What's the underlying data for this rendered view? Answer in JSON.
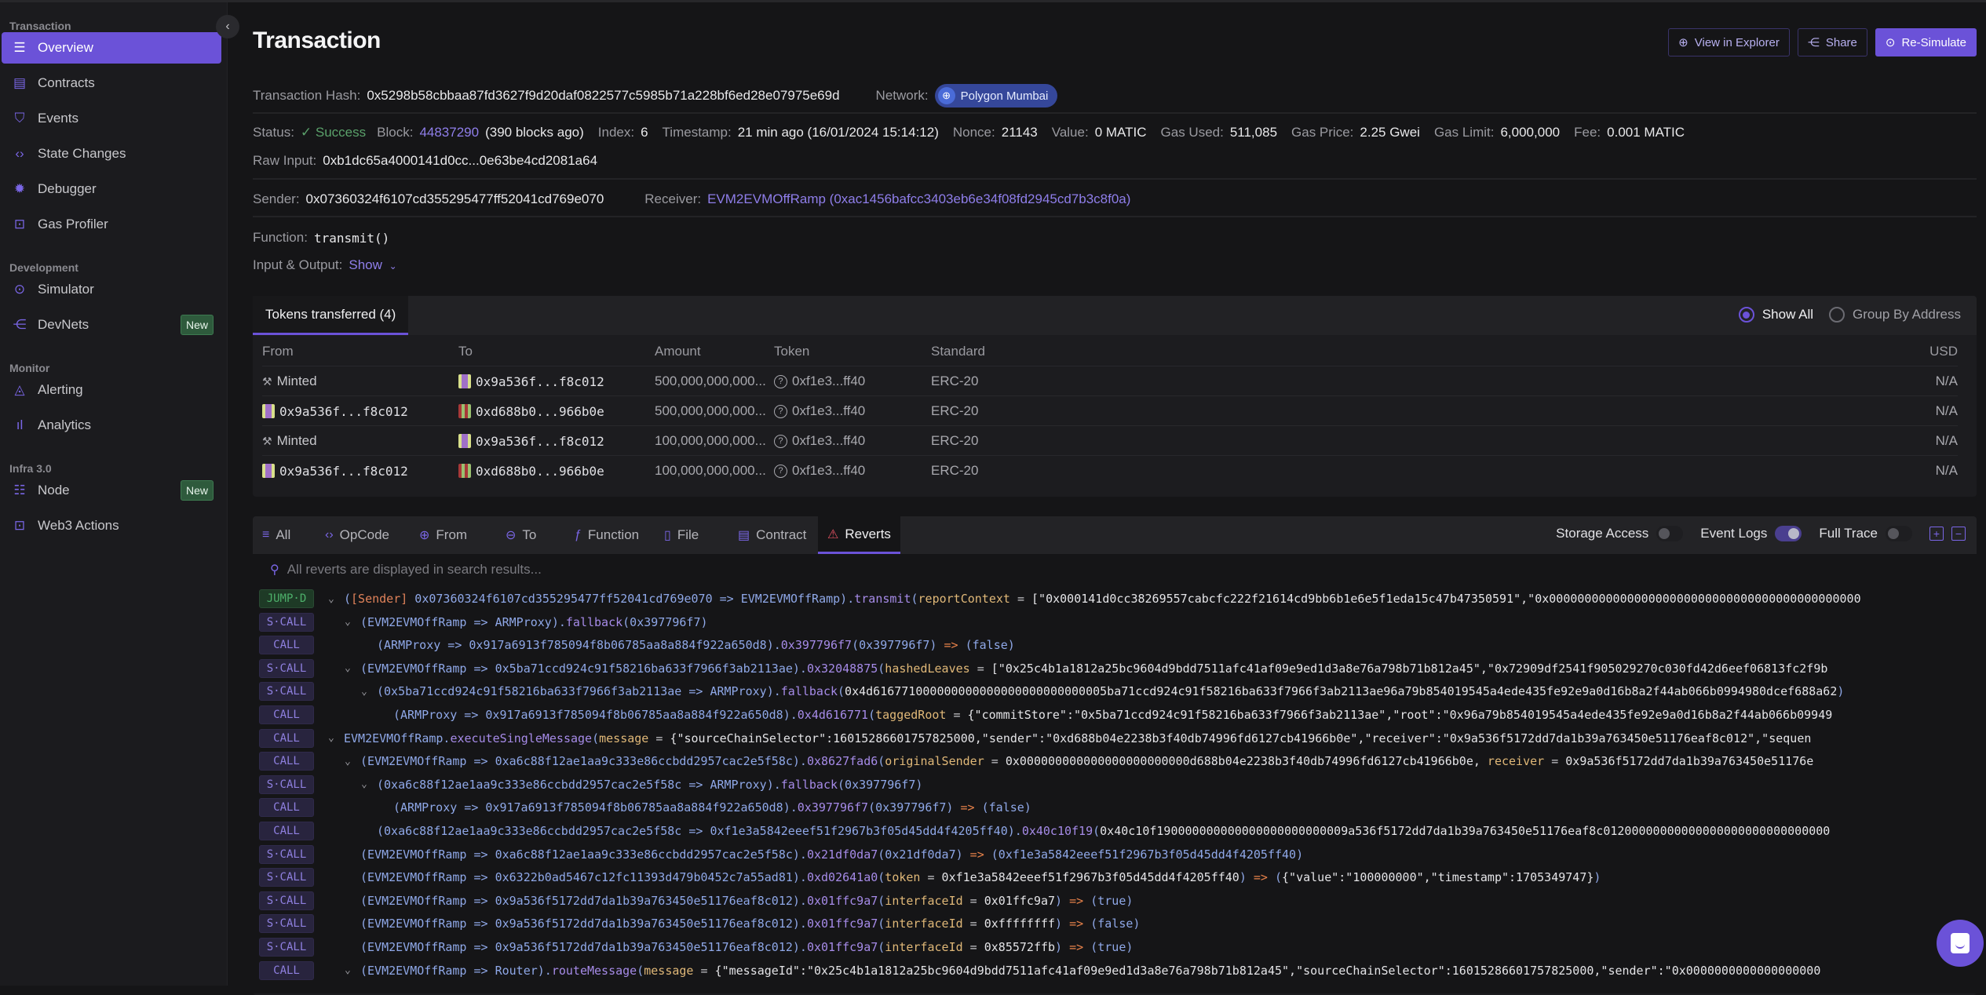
{
  "sidebar": {
    "sections": [
      {
        "title": "Transaction",
        "items": [
          {
            "label": "Overview",
            "icon": "list-icon",
            "active": true
          },
          {
            "label": "Contracts",
            "icon": "document-icon"
          },
          {
            "label": "Events",
            "icon": "bookmark-icon"
          },
          {
            "label": "State Changes",
            "icon": "code-icon"
          },
          {
            "label": "Debugger",
            "icon": "bug-icon"
          },
          {
            "label": "Gas Profiler",
            "icon": "chip-icon"
          }
        ]
      },
      {
        "title": "Development",
        "items": [
          {
            "label": "Simulator",
            "icon": "play-circle-icon"
          },
          {
            "label": "DevNets",
            "icon": "share-nodes-icon",
            "badge": "New"
          }
        ]
      },
      {
        "title": "Monitor",
        "items": [
          {
            "label": "Alerting",
            "icon": "bell-icon"
          },
          {
            "label": "Analytics",
            "icon": "bar-chart-icon"
          }
        ]
      },
      {
        "title": "Infra 3.0",
        "items": [
          {
            "label": "Node",
            "icon": "server-icon",
            "badge": "New"
          },
          {
            "label": "Web3 Actions",
            "icon": "chip-icon"
          }
        ]
      }
    ]
  },
  "header": {
    "title": "Transaction",
    "buttons": {
      "explorer": "View in Explorer",
      "share": "Share",
      "resimulate": "Re-Simulate"
    }
  },
  "tx": {
    "hash_label": "Transaction Hash:",
    "hash": "0x5298b58cbbaa87fd3627f9d20daf0822577c5985b71a228bf6ed28e07975e69d",
    "network_label": "Network:",
    "network": "Polygon Mumbai",
    "status_label": "Status:",
    "status": "✓ Success",
    "block_label": "Block:",
    "block": "44837290",
    "block_ago": "(390 blocks ago)",
    "index_label": "Index:",
    "index": "6",
    "timestamp_label": "Timestamp:",
    "timestamp": "21 min ago (16/01/2024 15:14:12)",
    "nonce_label": "Nonce:",
    "nonce": "21143",
    "value_label": "Value:",
    "value": "0 MATIC",
    "gas_used_label": "Gas Used:",
    "gas_used": "511,085",
    "gas_price_label": "Gas Price:",
    "gas_price": "2.25 Gwei",
    "gas_limit_label": "Gas Limit:",
    "gas_limit": "6,000,000",
    "fee_label": "Fee:",
    "fee": "0.001 MATIC",
    "raw_input_label": "Raw Input:",
    "raw_input": "0xb1dc65a4000141d0cc...0e63be4cd2081a64",
    "sender_label": "Sender:",
    "sender": "0x07360324f6107cd355295477ff52041cd769e070",
    "receiver_label": "Receiver:",
    "receiver": "EVM2EVMOffRamp (0xac1456bafcc3403eb6e34f08fd2945cd7b3c8f0a)",
    "function_label": "Function:",
    "function": "transmit()",
    "io_label": "Input & Output:",
    "io_toggle": "Show"
  },
  "tokens": {
    "tab": "Tokens transferred (4)",
    "radio_show_all": "Show All",
    "radio_group": "Group By Address",
    "columns": [
      "From",
      "To",
      "Amount",
      "Token",
      "Standard",
      "USD"
    ],
    "rows": [
      {
        "from": "Minted",
        "from_type": "minted",
        "to": "0x9a536f...f8c012",
        "to_blockie": "a",
        "amount": "500,000,000,000...",
        "token": "0xf1e3...ff40",
        "standard": "ERC-20",
        "usd": "N/A"
      },
      {
        "from": "0x9a536f...f8c012",
        "from_type": "a",
        "to": "0xd688b0...966b0e",
        "to_blockie": "b",
        "amount": "500,000,000,000...",
        "token": "0xf1e3...ff40",
        "standard": "ERC-20",
        "usd": "N/A"
      },
      {
        "from": "Minted",
        "from_type": "minted",
        "to": "0x9a536f...f8c012",
        "to_blockie": "a",
        "amount": "100,000,000,000...",
        "token": "0xf1e3...ff40",
        "standard": "ERC-20",
        "usd": "N/A"
      },
      {
        "from": "0x9a536f...f8c012",
        "from_type": "a",
        "to": "0xd688b0...966b0e",
        "to_blockie": "b",
        "amount": "100,000,000,000...",
        "token": "0xf1e3...ff40",
        "standard": "ERC-20",
        "usd": "N/A"
      }
    ]
  },
  "trace": {
    "tabs": [
      {
        "label": "All",
        "icon": "≡"
      },
      {
        "label": "OpCode",
        "icon": "‹›"
      },
      {
        "label": "From",
        "icon": "⊕"
      },
      {
        "label": "To",
        "icon": "⊖"
      },
      {
        "label": "Function",
        "icon": "ƒ"
      },
      {
        "label": "File",
        "icon": "▯"
      },
      {
        "label": "Contract",
        "icon": "▤"
      },
      {
        "label": "Reverts",
        "icon": "⚠",
        "active": true
      }
    ],
    "toggles": {
      "storage": "Storage Access",
      "events": "Event Logs",
      "full": "Full Trace"
    },
    "toggle_state": {
      "storage": false,
      "events": true,
      "full": false
    },
    "search_placeholder": "All reverts are displayed in search results...",
    "lines": [
      {
        "op": "JUMP·D",
        "depth": 0,
        "chev": true,
        "parts": [
          [
            "p",
            "("
          ],
          [
            "snd",
            "[Sender]"
          ],
          [
            "p",
            " 0x07360324f6107cd355295477ff52041cd769e070 => EVM2EVMOffRamp)."
          ],
          [
            "fn",
            "transmit"
          ],
          [
            "p",
            "("
          ],
          [
            "pm",
            "reportContext"
          ],
          [
            "w",
            " = "
          ],
          [
            "s",
            "[\"0x000141d0cc38269557cabcfc222f21614cd9bb6b1e6e5f1eda15c47b47350591\",\"0x00000000000000000000000000000000000000000000"
          ]
        ]
      },
      {
        "op": "S·CALL",
        "depth": 1,
        "chev": true,
        "parts": [
          [
            "p",
            "(EVM2EVMOffRamp => ARMProxy)."
          ],
          [
            "fn",
            "fallback"
          ],
          [
            "p",
            "(0x397796f7)"
          ]
        ]
      },
      {
        "op": "CALL",
        "depth": 2,
        "chev": false,
        "parts": [
          [
            "p",
            "(ARMProxy => 0x917a6913f785094f8b06785aa8a884f922a650d8)."
          ],
          [
            "fn",
            "0x397796f7"
          ],
          [
            "p",
            "(0x397796f7)"
          ],
          [
            "ar",
            " => "
          ],
          [
            "p",
            "(false)"
          ]
        ]
      },
      {
        "op": "S·CALL",
        "depth": 1,
        "chev": true,
        "parts": [
          [
            "p",
            "(EVM2EVMOffRamp => 0x5ba71ccd924c91f58216ba633f7966f3ab2113ae)."
          ],
          [
            "fn",
            "0x32048875"
          ],
          [
            "p",
            "("
          ],
          [
            "pm",
            "hashedLeaves"
          ],
          [
            "w",
            " = "
          ],
          [
            "s",
            "[\"0x25c4b1a1812a25bc9604d9bdd7511afc41af09e9ed1d3a8e76a798b71b812a45\",\"0x72909df2541f905029270c030fd42d6eef06813fc2f9b"
          ]
        ]
      },
      {
        "op": "S·CALL",
        "depth": 2,
        "chev": true,
        "parts": [
          [
            "p",
            "(0x5ba71ccd924c91f58216ba633f7966f3ab2113ae => ARMProxy)."
          ],
          [
            "fn",
            "fallback"
          ],
          [
            "p",
            "("
          ],
          [
            "s",
            "0x4d616771000000000000000000000000005ba71ccd924c91f58216ba633f7966f3ab2113ae96a79b854019545a4ede435fe92e9a0d16b8a2f44ab066b0994980dcef688a62"
          ],
          [
            "p",
            ")"
          ]
        ]
      },
      {
        "op": "CALL",
        "depth": 3,
        "chev": false,
        "parts": [
          [
            "p",
            "(ARMProxy => 0x917a6913f785094f8b06785aa8a884f922a650d8)."
          ],
          [
            "fn",
            "0x4d616771"
          ],
          [
            "p",
            "("
          ],
          [
            "pm",
            "taggedRoot"
          ],
          [
            "w",
            " = "
          ],
          [
            "s",
            "{\"commitStore\":\"0x5ba71ccd924c91f58216ba633f7966f3ab2113ae\",\"root\":\"0x96a79b854019545a4ede435fe92e9a0d16b8a2f44ab066b09949"
          ]
        ]
      },
      {
        "op": "CALL",
        "depth": 0,
        "chev": true,
        "parts": [
          [
            "p",
            "EVM2EVMOffRamp."
          ],
          [
            "fn",
            "executeSingleMessage"
          ],
          [
            "p",
            "("
          ],
          [
            "pm",
            "message"
          ],
          [
            "w",
            " = "
          ],
          [
            "s",
            "{\"sourceChainSelector\":16015286601757825000,\"sender\":\"0xd688b04e2238b3f40db74996fd6127cb41966b0e\",\"receiver\":\"0x9a536f5172dd7da1b39a763450e51176eaf8c012\",\"sequen"
          ]
        ]
      },
      {
        "op": "CALL",
        "depth": 1,
        "chev": true,
        "parts": [
          [
            "p",
            "(EVM2EVMOffRamp => 0xa6c88f12ae1aa9c333e86ccbdd2957cac2e5f58c)."
          ],
          [
            "fn",
            "0x8627fad6"
          ],
          [
            "p",
            "("
          ],
          [
            "pm",
            "originalSender"
          ],
          [
            "w",
            " = "
          ],
          [
            "s",
            "0x000000000000000000000000d688b04e2238b3f40db74996fd6127cb41966b0e, "
          ],
          [
            "pm",
            "receiver"
          ],
          [
            "w",
            " = "
          ],
          [
            "s",
            "0x9a536f5172dd7da1b39a763450e51176e"
          ]
        ]
      },
      {
        "op": "S·CALL",
        "depth": 2,
        "chev": true,
        "parts": [
          [
            "p",
            "(0xa6c88f12ae1aa9c333e86ccbdd2957cac2e5f58c => ARMProxy)."
          ],
          [
            "fn",
            "fallback"
          ],
          [
            "p",
            "(0x397796f7)"
          ]
        ]
      },
      {
        "op": "CALL",
        "depth": 3,
        "chev": false,
        "parts": [
          [
            "p",
            "(ARMProxy => 0x917a6913f785094f8b06785aa8a884f922a650d8)."
          ],
          [
            "fn",
            "0x397796f7"
          ],
          [
            "p",
            "(0x397796f7)"
          ],
          [
            "ar",
            " => "
          ],
          [
            "p",
            "(false)"
          ]
        ]
      },
      {
        "op": "CALL",
        "depth": 2,
        "chev": false,
        "parts": [
          [
            "p",
            "(0xa6c88f12ae1aa9c333e86ccbdd2957cac2e5f58c => 0xf1e3a5842eeef51f2967b3f05d45dd4f4205ff40)."
          ],
          [
            "fn",
            "0x40c10f19"
          ],
          [
            "p",
            "("
          ],
          [
            "s",
            "0x40c10f190000000000000000000000009a536f5172dd7da1b39a763450e51176eaf8c01200000000000000000000000000000"
          ]
        ]
      },
      {
        "op": "S·CALL",
        "depth": 1,
        "chev": false,
        "parts": [
          [
            "p",
            "(EVM2EVMOffRamp => 0xa6c88f12ae1aa9c333e86ccbdd2957cac2e5f58c)."
          ],
          [
            "fn",
            "0x21df0da7"
          ],
          [
            "p",
            "(0x21df0da7)"
          ],
          [
            "ar",
            " => "
          ],
          [
            "p",
            "(0xf1e3a5842eeef51f2967b3f05d45dd4f4205ff40)"
          ]
        ]
      },
      {
        "op": "S·CALL",
        "depth": 1,
        "chev": false,
        "parts": [
          [
            "p",
            "(EVM2EVMOffRamp => 0x6322b0ad5467c12fc11393d479b0452c7a55ad81)."
          ],
          [
            "fn",
            "0xd02641a0"
          ],
          [
            "p",
            "("
          ],
          [
            "pm",
            "token"
          ],
          [
            "w",
            " = "
          ],
          [
            "s",
            "0xf1e3a5842eeef51f2967b3f05d45dd4f4205ff40"
          ],
          [
            "p",
            ")"
          ],
          [
            "ar",
            " => "
          ],
          [
            "p",
            "("
          ],
          [
            "s",
            "{\"value\":\"100000000\",\"timestamp\":1705349747}"
          ],
          [
            "p",
            ")"
          ]
        ]
      },
      {
        "op": "S·CALL",
        "depth": 1,
        "chev": false,
        "parts": [
          [
            "p",
            "(EVM2EVMOffRamp => 0x9a536f5172dd7da1b39a763450e51176eaf8c012)."
          ],
          [
            "fn",
            "0x01ffc9a7"
          ],
          [
            "p",
            "("
          ],
          [
            "pm",
            "interfaceId"
          ],
          [
            "w",
            " = "
          ],
          [
            "s",
            "0x01ffc9a7"
          ],
          [
            "p",
            ")"
          ],
          [
            "ar",
            " => "
          ],
          [
            "p",
            "(true)"
          ]
        ]
      },
      {
        "op": "S·CALL",
        "depth": 1,
        "chev": false,
        "parts": [
          [
            "p",
            "(EVM2EVMOffRamp => 0x9a536f5172dd7da1b39a763450e51176eaf8c012)."
          ],
          [
            "fn",
            "0x01ffc9a7"
          ],
          [
            "p",
            "("
          ],
          [
            "pm",
            "interfaceId"
          ],
          [
            "w",
            " = "
          ],
          [
            "s",
            "0xffffffff"
          ],
          [
            "p",
            ")"
          ],
          [
            "ar",
            " => "
          ],
          [
            "p",
            "(false)"
          ]
        ]
      },
      {
        "op": "S·CALL",
        "depth": 1,
        "chev": false,
        "parts": [
          [
            "p",
            "(EVM2EVMOffRamp => 0x9a536f5172dd7da1b39a763450e51176eaf8c012)."
          ],
          [
            "fn",
            "0x01ffc9a7"
          ],
          [
            "p",
            "("
          ],
          [
            "pm",
            "interfaceId"
          ],
          [
            "w",
            " = "
          ],
          [
            "s",
            "0x85572ffb"
          ],
          [
            "p",
            ")"
          ],
          [
            "ar",
            " => "
          ],
          [
            "p",
            "(true)"
          ]
        ]
      },
      {
        "op": "CALL",
        "depth": 1,
        "chev": true,
        "parts": [
          [
            "p",
            "(EVM2EVMOffRamp => Router)."
          ],
          [
            "fn",
            "routeMessage"
          ],
          [
            "p",
            "("
          ],
          [
            "pm",
            "message"
          ],
          [
            "w",
            " = "
          ],
          [
            "s",
            "{\"messageId\":\"0x25c4b1a1812a25bc9604d9bdd7511afc41af09e9ed1d3a8e76a798b71b812a45\",\"sourceChainSelector\":16015286601757825000,\"sender\":\"0x0000000000000000000"
          ]
        ]
      }
    ]
  }
}
